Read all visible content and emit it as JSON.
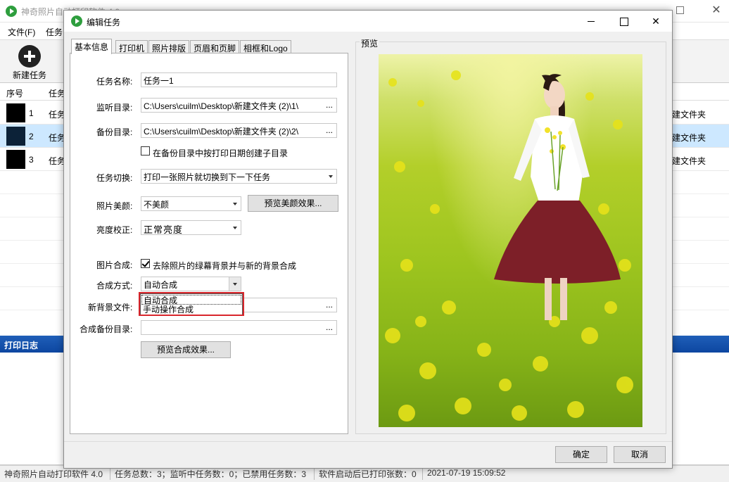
{
  "main_window": {
    "title": "神奇照片自动打印软件 4.0",
    "menu": [
      "文件(F)",
      "任务"
    ],
    "toolbar": {
      "new_task": "新建任务"
    },
    "table": {
      "headers": [
        "序号",
        "任务"
      ],
      "rows": [
        {
          "num": "1",
          "name": "任务",
          "dir": "建文件夹"
        },
        {
          "num": "2",
          "name": "任务",
          "dir": "建文件夹"
        },
        {
          "num": "3",
          "name": "任务",
          "dir": "建文件夹"
        }
      ]
    },
    "log_title": "打印日志",
    "status": {
      "app": "神奇照片自动打印软件 4.0",
      "total": "任务总数：3；监听中任务数：0；已禁用任务数：3",
      "printed": "软件启动后已打印张数：0",
      "time": "2021-07-19 15:09:52"
    }
  },
  "dialog": {
    "title": "编辑任务",
    "tabs": [
      "基本信息",
      "打印机",
      "照片排版",
      "页眉和页脚",
      "相框和Logo"
    ],
    "form": {
      "task_name_label": "任务名称:",
      "task_name_value": "任务一1",
      "watch_dir_label": "监听目录:",
      "watch_dir_value": "C:\\Users\\cuilm\\Desktop\\新建文件夹 (2)\\1\\",
      "backup_dir_label": "备份目录:",
      "backup_dir_value": "C:\\Users\\cuilm\\Desktop\\新建文件夹 (2)\\2\\",
      "date_subdir_label": "在备份目录中按打印日期创建子目录",
      "task_switch_label": "任务切换:",
      "task_switch_value": "打印一张照片就切换到下一下任务",
      "beauty_label": "照片美颜:",
      "beauty_value": "不美颜",
      "beauty_preview_btn": "预览美颜效果...",
      "brightness_label": "亮度校正:",
      "brightness_value": "正常亮度",
      "compose_label": "图片合成:",
      "compose_check_label": "去除照片的绿幕背景并与新的背景合成",
      "compose_mode_label": "合成方式:",
      "compose_mode_value": "自动合成",
      "compose_mode_options": [
        "自动合成",
        "手动操作合成"
      ],
      "new_bg_label": "新背景文件:",
      "compose_backup_label": "合成备份目录:",
      "compose_preview_btn": "预览合成效果...",
      "browse": "..."
    },
    "preview_label": "预览",
    "ok": "确定",
    "cancel": "取消"
  }
}
